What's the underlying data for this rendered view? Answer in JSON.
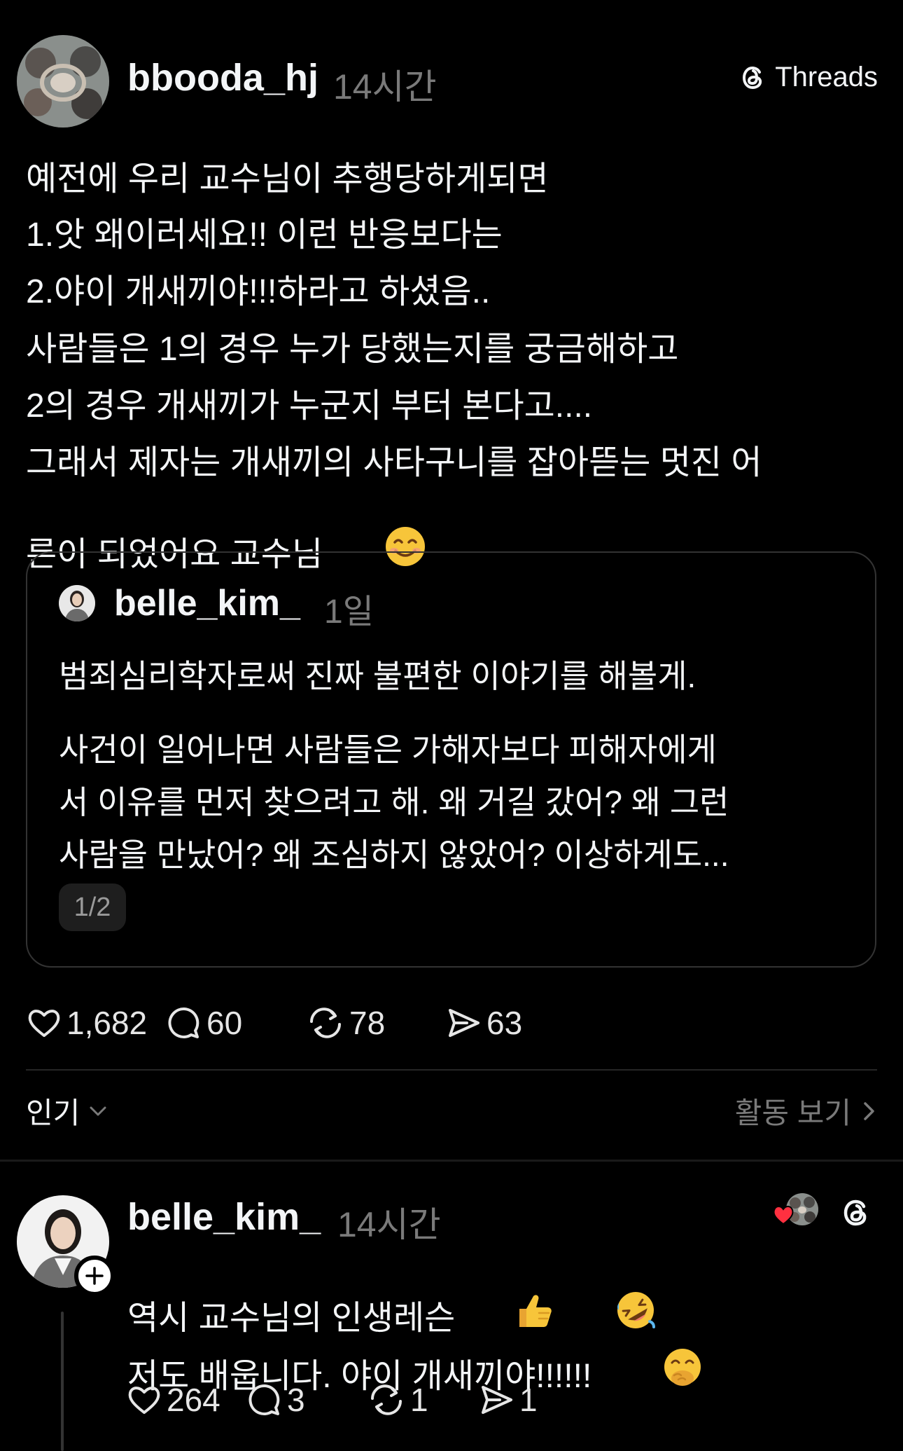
{
  "post": {
    "author": "bbooda_hj",
    "time": "14시간",
    "platform": "Threads",
    "lines": [
      "예전에 우리 교수님이 추행당하게되면",
      "1.앗 왜이러세요!! 이런 반응보다는",
      "2.야이 개새끼야!!!하라고 하셨음..",
      "사람들은 1의 경우 누가 당했는지를 궁금해하고",
      "2의 경우 개새끼가 누군지 부터 본다고....",
      "그래서 제자는 개새끼의 사타구니를 잡아뜯는 멋진 어",
      "른이 되었어요 교수님"
    ],
    "quote": {
      "author": "belle_kim_",
      "time": "1일",
      "line1": "범죄심리학자로써 진짜 불편한 이야기를 해볼게.",
      "paragraph": [
        "사건이 일어나면 사람들은 가해자보다 피해자에게",
        "서 이유를 먼저 찾으려고 해. 왜 거길 갔어? 왜 그런",
        "사람을 만났어? 왜 조심하지 않았어? 이상하게도..."
      ],
      "page": "1/2"
    },
    "actions": {
      "likes": "1,682",
      "comments": "60",
      "reposts": "78",
      "shares": "63"
    }
  },
  "sort": {
    "label": "인기",
    "activity": "활동 보기"
  },
  "reply": {
    "author": "belle_kim_",
    "time": "14시간",
    "line1": "역시 교수님의 인생레슨",
    "line2": "저도 배웁니다. 야이 개새끼야!!!!!!",
    "actions": {
      "likes": "264",
      "comments": "3",
      "reposts": "1",
      "shares": "1"
    }
  },
  "icons": {
    "like": "heart-icon",
    "comment": "comment-icon",
    "repost": "repost-icon",
    "share": "share-icon",
    "threads": "threads-logo-icon"
  }
}
